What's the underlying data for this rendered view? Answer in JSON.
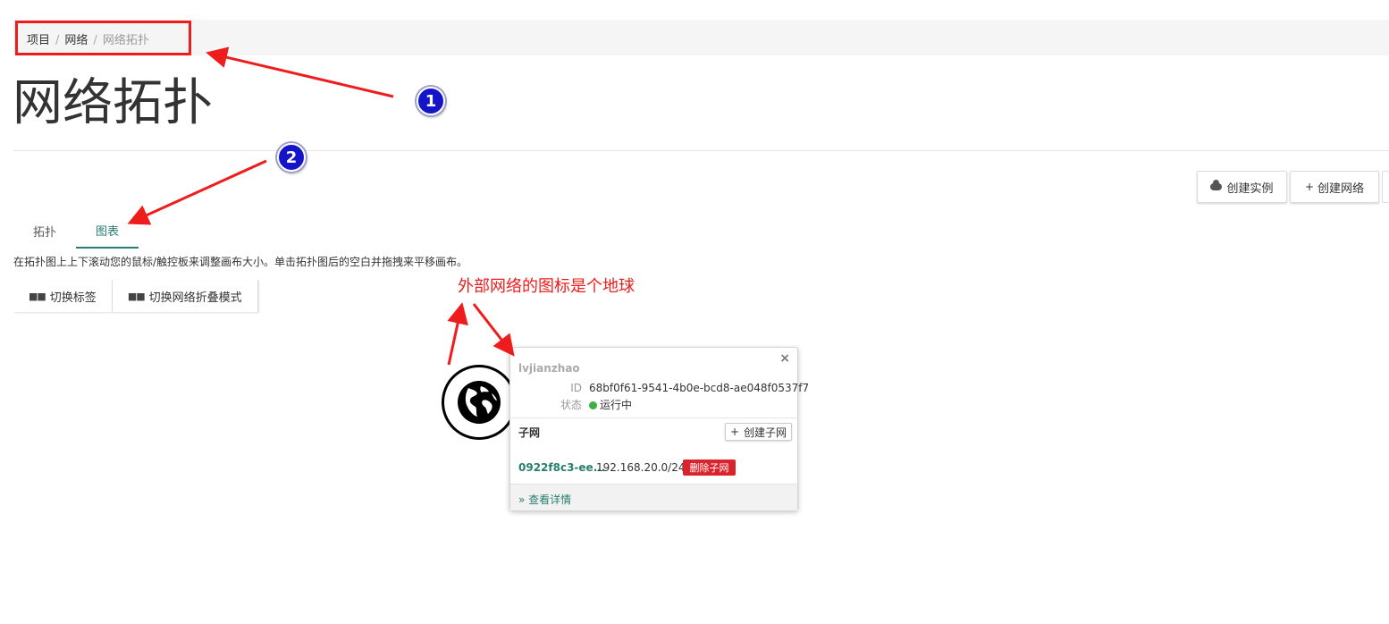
{
  "breadcrumb": {
    "items": [
      "项目",
      "网络",
      "网络拓扑"
    ],
    "separator": "/"
  },
  "page": {
    "title": "网络拓扑"
  },
  "actions": {
    "create_instance": "创建实例",
    "create_network": "创建网络"
  },
  "tabs": [
    {
      "label": "拓扑",
      "active": false
    },
    {
      "label": "图表",
      "active": true
    }
  ],
  "help_text": "在拓扑图上上下滚动您的鼠标/触控板来调整画布大小。单击拓扑图后的空白并拖拽来平移画布。",
  "toggles": {
    "toggle_labels": "切换标签",
    "toggle_collapse": "切换网络折叠模式"
  },
  "annotations": {
    "badge_1": "1",
    "badge_2": "2",
    "note": "外部网络的图标是个地球",
    "highlight_color": "#ee1c1c",
    "badge_color": "#1414c8"
  },
  "node": {
    "icon": "globe-icon"
  },
  "popup": {
    "close": "×",
    "name": "lvjianzhao",
    "id_label": "ID",
    "id_value": "68bf0f61-9541-4b0e-bcd8-ae048f0537f7",
    "status_label": "状态",
    "status_value": "运行中",
    "status_color": "#3cb043",
    "subnet_heading": "子网",
    "create_subnet": "创建子网",
    "subnet": {
      "id": "0922f8c3-ee...",
      "cidr": "192.168.20.0/24",
      "delete_label": "删除子网"
    },
    "view_details": "» 查看详情"
  },
  "colors": {
    "accent": "#277e6f",
    "danger": "#d9232d"
  }
}
